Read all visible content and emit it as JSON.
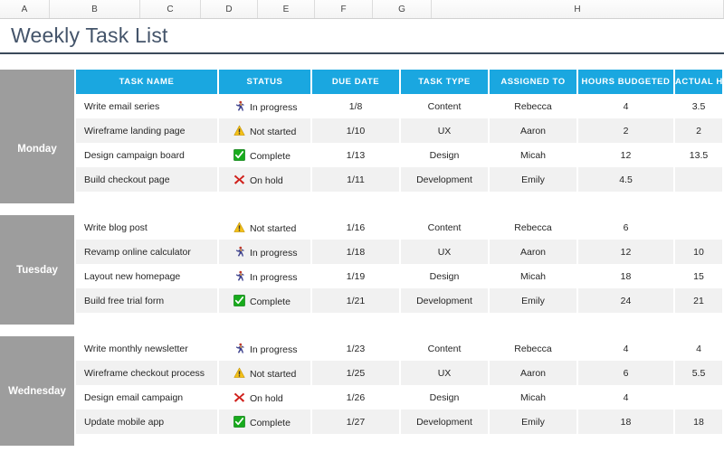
{
  "spreadsheet": {
    "column_letters": [
      "A",
      "B",
      "C",
      "D",
      "E",
      "F",
      "G",
      "H"
    ],
    "title": "Weekly Task List"
  },
  "table": {
    "headers": {
      "day": "",
      "task_name": "TASK NAME",
      "status": "STATUS",
      "due_date": "DUE DATE",
      "task_type": "TASK TYPE",
      "assigned_to": "ASSIGNED TO",
      "hours_budgeted": "HOURS BUDGETED",
      "actual_hours": "ACTUAL HOURS"
    },
    "colors": {
      "header_blue": "#1aa7e0",
      "day_gray": "#9d9d9d",
      "title_text": "#44546a",
      "row_alt": "#f1f1f1"
    },
    "status_labels": {
      "in_progress": "In progress",
      "not_started": "Not started",
      "complete": "Complete",
      "on_hold": "On hold"
    },
    "groups": [
      {
        "day": "Monday",
        "rows": [
          {
            "task": "Write email series",
            "status": "In progress",
            "status_icon": "runner-icon",
            "due": "1/8",
            "type": "Content",
            "assignee": "Rebecca",
            "budget": "4",
            "actual": "3.5"
          },
          {
            "task": "Wireframe landing page",
            "status": "Not started",
            "status_icon": "warning-triangle-icon",
            "due": "1/10",
            "type": "UX",
            "assignee": "Aaron",
            "budget": "2",
            "actual": "2"
          },
          {
            "task": "Design campaign board",
            "status": "Complete",
            "status_icon": "green-check-icon",
            "due": "1/13",
            "type": "Design",
            "assignee": "Micah",
            "budget": "12",
            "actual": "13.5"
          },
          {
            "task": "Build checkout page",
            "status": "On hold",
            "status_icon": "red-x-icon",
            "due": "1/11",
            "type": "Development",
            "assignee": "Emily",
            "budget": "4.5",
            "actual": ""
          }
        ]
      },
      {
        "day": "Tuesday",
        "rows": [
          {
            "task": "Write blog post",
            "status": "Not started",
            "status_icon": "warning-triangle-icon",
            "due": "1/16",
            "type": "Content",
            "assignee": "Rebecca",
            "budget": "6",
            "actual": ""
          },
          {
            "task": "Revamp online calculator",
            "status": "In progress",
            "status_icon": "runner-icon",
            "due": "1/18",
            "type": "UX",
            "assignee": "Aaron",
            "budget": "12",
            "actual": "10"
          },
          {
            "task": "Layout new homepage",
            "status": "In progress",
            "status_icon": "runner-icon",
            "due": "1/19",
            "type": "Design",
            "assignee": "Micah",
            "budget": "18",
            "actual": "15"
          },
          {
            "task": "Build free trial form",
            "status": "Complete",
            "status_icon": "green-check-icon",
            "due": "1/21",
            "type": "Development",
            "assignee": "Emily",
            "budget": "24",
            "actual": "21"
          }
        ]
      },
      {
        "day": "Wednesday",
        "rows": [
          {
            "task": "Write monthly newsletter",
            "status": "In progress",
            "status_icon": "runner-icon",
            "due": "1/23",
            "type": "Content",
            "assignee": "Rebecca",
            "budget": "4",
            "actual": "4"
          },
          {
            "task": "Wireframe checkout process",
            "status": "Not started",
            "status_icon": "warning-triangle-icon",
            "due": "1/25",
            "type": "UX",
            "assignee": "Aaron",
            "budget": "6",
            "actual": "5.5"
          },
          {
            "task": "Design email campaign",
            "status": "On hold",
            "status_icon": "red-x-icon",
            "due": "1/26",
            "type": "Design",
            "assignee": "Micah",
            "budget": "4",
            "actual": ""
          },
          {
            "task": "Update mobile app",
            "status": "Complete",
            "status_icon": "green-check-icon",
            "due": "1/27",
            "type": "Development",
            "assignee": "Emily",
            "budget": "18",
            "actual": "18"
          }
        ]
      }
    ]
  }
}
